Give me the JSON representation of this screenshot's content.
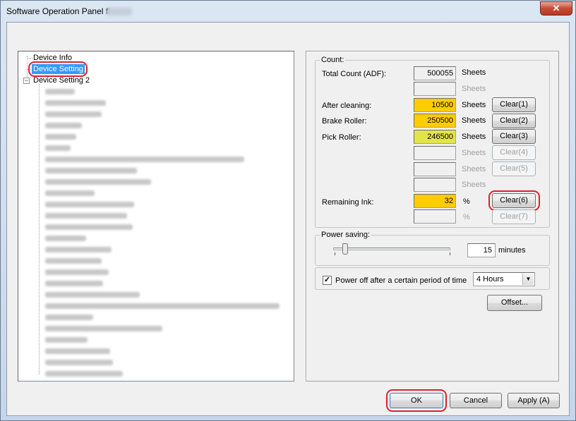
{
  "window": {
    "title": "Software Operation Panel fi-",
    "close_icon": "close-icon"
  },
  "tree": {
    "device_info": "Device Info",
    "device_setting": "Device Setting",
    "device_setting_2": "Device Setting 2",
    "blurred_item_count_note": "",
    "expander_symbol": "−"
  },
  "count": {
    "legend": "Count:",
    "rows": [
      {
        "label": "Total Count (ADF):",
        "value": "500055",
        "unit": "Sheets",
        "button": ""
      },
      {
        "label": "",
        "value": "",
        "unit": "Sheets",
        "button": ""
      },
      {
        "label": "After cleaning:",
        "value": "10500",
        "unit": "Sheets",
        "button": "Clear(1)"
      },
      {
        "label": "Brake Roller:",
        "value": "250500",
        "unit": "Sheets",
        "button": "Clear(2)"
      },
      {
        "label": "Pick Roller:",
        "value": "246500",
        "unit": "Sheets",
        "button": "Clear(3)"
      },
      {
        "label": "",
        "value": "",
        "unit": "Sheets",
        "button": "Clear(4)"
      },
      {
        "label": "",
        "value": "",
        "unit": "Sheets",
        "button": "Clear(5)"
      },
      {
        "label": "",
        "value": "",
        "unit": "Sheets",
        "button": ""
      },
      {
        "label": "Remaining Ink:",
        "value": "32",
        "unit": "%",
        "button": "Clear(6)"
      },
      {
        "label": "",
        "value": "",
        "unit": "%",
        "button": "Clear(7)"
      }
    ]
  },
  "power": {
    "legend": "Power saving:",
    "minutes_value": "15",
    "minutes_unit": "minutes",
    "slider_level": 0.08,
    "checkbox_checked": "✓",
    "power_off_label": "Power off after a certain period of time",
    "power_off_select": "4 Hours"
  },
  "buttons": {
    "offset": "Offset...",
    "ok": "OK",
    "cancel": "Cancel",
    "apply": "Apply (A)"
  },
  "colors": {
    "highlight_ring": "#e0202a",
    "selection": "#3399ff",
    "warning_yellow": "#ffcc00"
  }
}
